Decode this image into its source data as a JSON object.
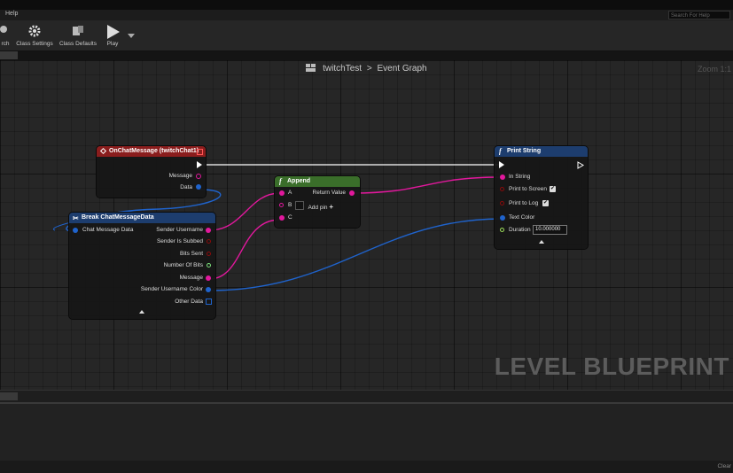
{
  "menu": {
    "help": "Help",
    "search_placeholder": "Search For Help"
  },
  "toolbar": {
    "search_label": "rch",
    "class_settings": "Class Settings",
    "class_defaults": "Class Defaults",
    "play": "Play"
  },
  "graph": {
    "breadcrumb_asset": "twitchTest",
    "breadcrumb_sep": ">",
    "breadcrumb_graph": "Event Graph",
    "zoom": "Zoom 1:1",
    "watermark": "LEVEL BLUEPRINT"
  },
  "nodes": {
    "event": {
      "title": "OnChatMessage (twitchChat1)",
      "pins": [
        "Message",
        "Data"
      ],
      "color": "#8a1d1d"
    },
    "break": {
      "title": "Break ChatMessageData",
      "input": "Chat Message Data",
      "pins": [
        "Sender Username",
        "Sender Is Subbed",
        "Bits Sent",
        "Number Of Bits",
        "Message",
        "Sender Username Color",
        "Other Data"
      ],
      "color": "#1d3d6e"
    },
    "append": {
      "title": "Append",
      "inputs": [
        "A",
        "B",
        "C"
      ],
      "output": "Return Value",
      "add_pin": "Add pin",
      "color": "#3a6e2a"
    },
    "print": {
      "title": "Print String",
      "pins": [
        "In String",
        "Print to Screen",
        "Print to Log",
        "Text Color",
        "Duration"
      ],
      "duration_value": "10.000000",
      "color": "#1d3d6e"
    }
  },
  "status": {
    "clear": "Clear"
  },
  "colors": {
    "string_pin": "#e2189d",
    "struct_pin": "#1f63cc",
    "exec_wire": "#ffffff"
  }
}
